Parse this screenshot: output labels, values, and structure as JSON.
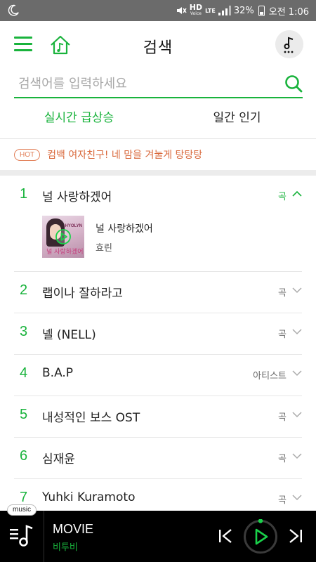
{
  "status_bar": {
    "hd": "HD",
    "voice": "Voice",
    "lte": "LTE",
    "battery": "32%",
    "time": "오전 1:06"
  },
  "header": {
    "title": "검색"
  },
  "search": {
    "placeholder": "검색어를 입력하세요"
  },
  "tabs": [
    {
      "label": "실시간 급상승",
      "active": true
    },
    {
      "label": "일간 인기",
      "active": false
    }
  ],
  "hot": {
    "badge": "HOT",
    "text": "컴백 여자친구! 네 맘을 겨눌게 탕탕탕"
  },
  "list": [
    {
      "rank": "1",
      "title": "널 사랑하겠어",
      "type": "곡",
      "expanded": true,
      "sub": {
        "title": "널 사랑하겠어",
        "artist": "효린",
        "album_lettering": "널 사랑하겠어",
        "album_brand": "HYOLYN"
      }
    },
    {
      "rank": "2",
      "title": "랩이나 잘하라고",
      "type": "곡"
    },
    {
      "rank": "3",
      "title": "넬 (NELL)",
      "type": "곡"
    },
    {
      "rank": "4",
      "title": "B.A.P",
      "type": "아티스트"
    },
    {
      "rank": "5",
      "title": "내성적인 보스 OST",
      "type": "곡"
    },
    {
      "rank": "6",
      "title": "심재윤",
      "type": "곡"
    },
    {
      "rank": "7",
      "title": "Yuhki Kuramoto",
      "type": "곡"
    }
  ],
  "player": {
    "tag": "music",
    "title": "MOVIE",
    "artist": "비투비"
  },
  "colors": {
    "accent": "#19b33c",
    "hot": "#d9683b",
    "player_bg": "#000000",
    "status_bar": "#6b6b6b"
  },
  "icons": {
    "menu": "menu-icon",
    "home": "home-music-icon",
    "profile": "music-note-more-icon",
    "search": "search-icon",
    "expand": "chevron-down-icon",
    "collapse": "chevron-up-icon",
    "play": "play-icon",
    "prev": "skip-previous-icon",
    "next": "skip-next-icon",
    "playlist": "playlist-icon"
  }
}
